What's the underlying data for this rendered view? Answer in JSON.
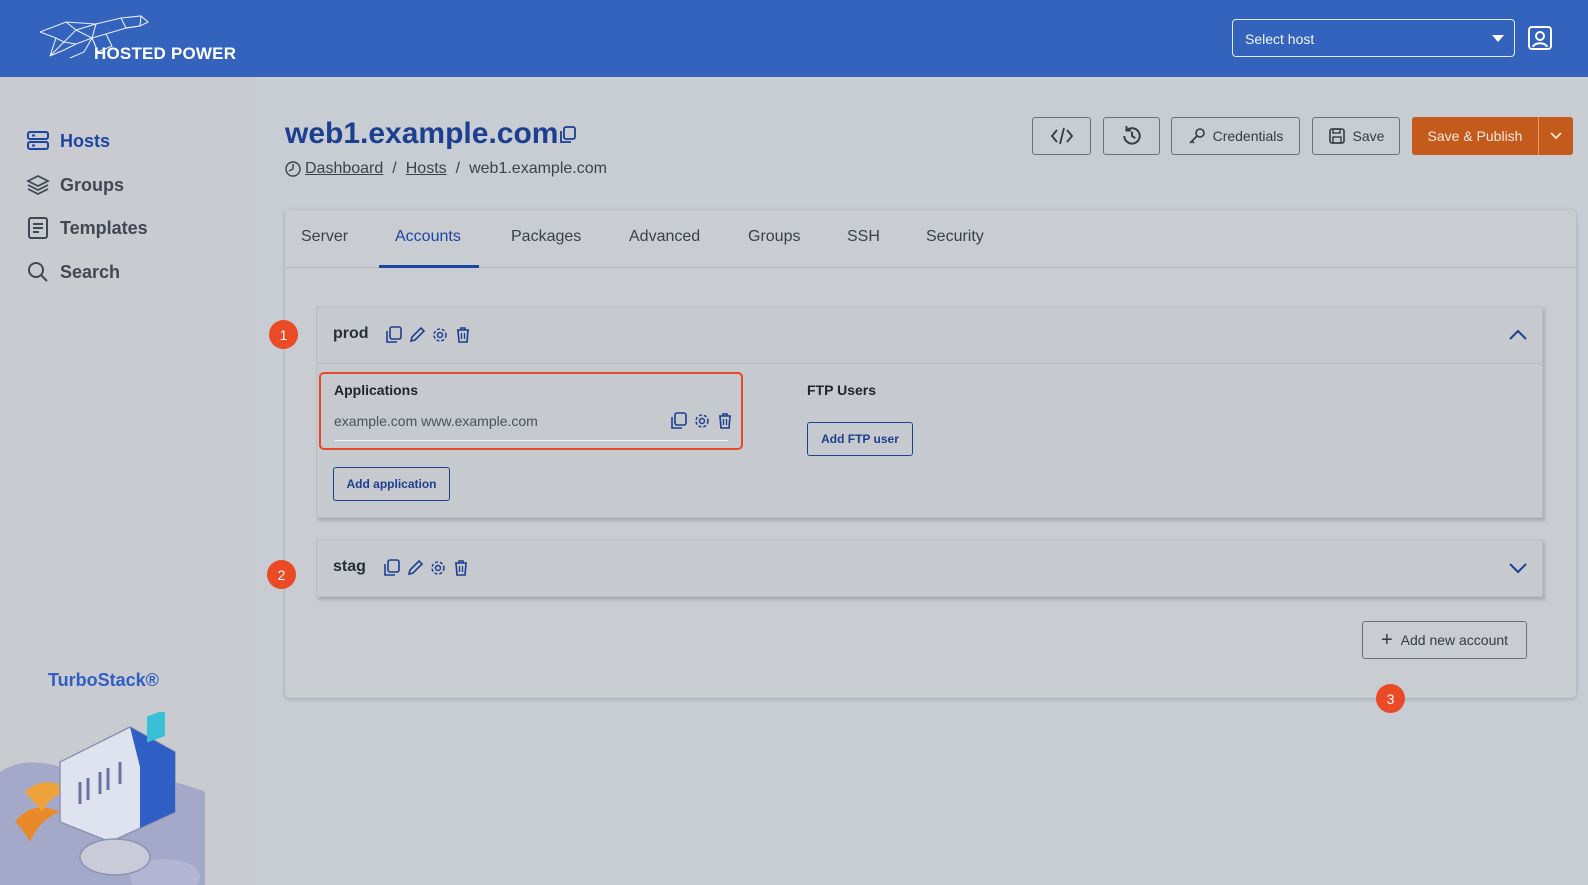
{
  "header": {
    "brand_name": "HOSTED POWER",
    "host_select": {
      "placeholder": "Select host"
    },
    "icons": {
      "caret": "caret-down-icon",
      "user": "user-icon"
    }
  },
  "sidebar": {
    "items": [
      {
        "label": "Hosts",
        "icon": "server-icon",
        "active": true
      },
      {
        "label": "Groups",
        "icon": "layers-icon",
        "active": false
      },
      {
        "label": "Templates",
        "icon": "document-icon",
        "active": false
      },
      {
        "label": "Search",
        "icon": "search-icon",
        "active": false
      }
    ],
    "product_name": "TurboStack®"
  },
  "page": {
    "title": "web1.example.com",
    "breadcrumb": [
      "Dashboard",
      "Hosts",
      "web1.example.com"
    ],
    "breadcrumb_sep": "/"
  },
  "toolbar": {
    "code_icon": "code-icon",
    "history_icon": "history-icon",
    "credentials_label": "Credentials",
    "save_label": "Save",
    "publish_label": "Save & Publish"
  },
  "tabs": [
    {
      "label": "Server",
      "active": false
    },
    {
      "label": "Accounts",
      "active": true
    },
    {
      "label": "Packages",
      "active": false
    },
    {
      "label": "Advanced",
      "active": false
    },
    {
      "label": "Groups",
      "active": false
    },
    {
      "label": "SSH",
      "active": false
    },
    {
      "label": "Security",
      "active": false
    }
  ],
  "accounts": [
    {
      "name": "prod",
      "expanded": true,
      "applications_title": "Applications",
      "applications": [
        {
          "domains": "example.com www.example.com"
        }
      ],
      "add_application_label": "Add application",
      "ftp_title": "FTP Users",
      "add_ftp_label": "Add FTP user",
      "badge": "1"
    },
    {
      "name": "stag",
      "expanded": false,
      "badge": "2"
    }
  ],
  "add_account": {
    "label": "Add new account",
    "badge": "3"
  },
  "colors": {
    "topbar": "#3363bd",
    "primary": "#1d46a3",
    "publish": "#c55a1d",
    "badge": "#ea4a25",
    "highlight_border": "#e44a2a"
  }
}
